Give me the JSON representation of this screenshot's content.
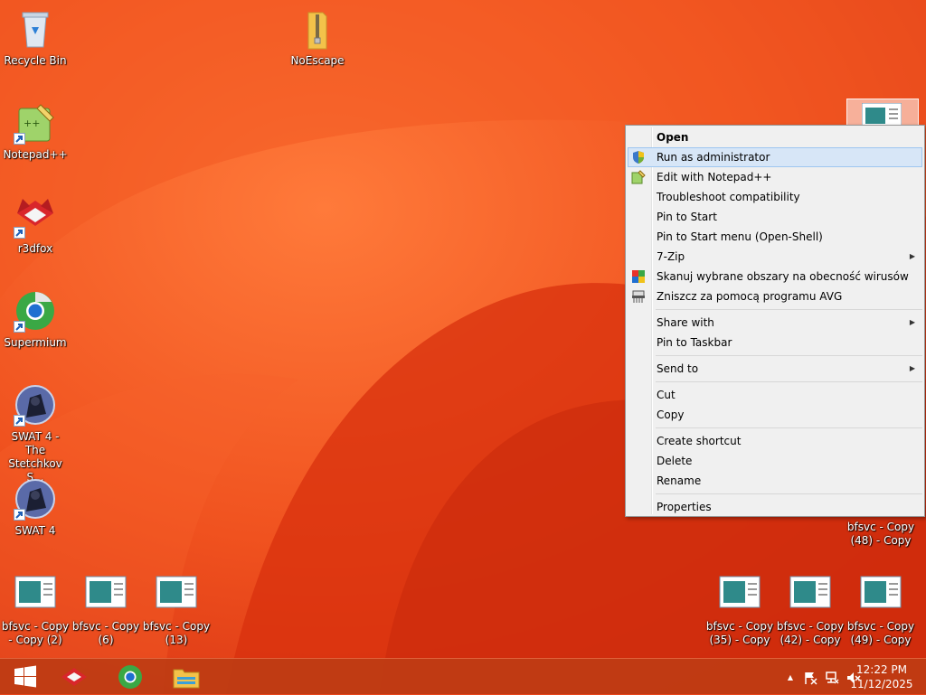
{
  "desktop": {
    "icons": [
      {
        "label": "Recycle Bin"
      },
      {
        "label": "NoEscape"
      },
      {
        "label": "Notepad++"
      },
      {
        "label": "r3dfox"
      },
      {
        "label": "Supermium"
      },
      {
        "label": "SWAT 4 - The Stetchkov S..."
      },
      {
        "label": "SWAT 4"
      },
      {
        "label": "bfsvc - Copy - Copy (2)"
      },
      {
        "label": "bfsvc - Copy (6)"
      },
      {
        "label": "bfsvc - Copy (13)"
      },
      {
        "label": "bfsvc - Copy (35) - Copy"
      },
      {
        "label": "bfsvc - Copy (42) - Copy"
      },
      {
        "label": "bfsvc - Copy (49) - Copy"
      },
      {
        "label": "bfsvc - Copy (48) - Copy"
      }
    ]
  },
  "context_menu": {
    "items": [
      {
        "label": "Open"
      },
      {
        "label": "Run as administrator"
      },
      {
        "label": "Edit with Notepad++"
      },
      {
        "label": "Troubleshoot compatibility"
      },
      {
        "label": "Pin to Start"
      },
      {
        "label": "Pin to Start menu (Open-Shell)"
      },
      {
        "label": "7-Zip"
      },
      {
        "label": "Skanuj wybrane obszary na obecność wirusów"
      },
      {
        "label": "Zniszcz za pomocą programu AVG"
      },
      {
        "label": "Share with"
      },
      {
        "label": "Pin to Taskbar"
      },
      {
        "label": "Send to"
      },
      {
        "label": "Cut"
      },
      {
        "label": "Copy"
      },
      {
        "label": "Create shortcut"
      },
      {
        "label": "Delete"
      },
      {
        "label": "Rename"
      },
      {
        "label": "Properties"
      }
    ],
    "submenu_glyph": "▶"
  },
  "taskbar": {
    "pinned": [
      "start-icon",
      "r3dfox-icon",
      "supermium-icon",
      "file-explorer-icon"
    ],
    "clock_time": "12:22 PM",
    "clock_date": "11/12/2025",
    "tray_chevron": "▲"
  },
  "colors": {
    "wallpaper": "#e8461a",
    "menu_highlight": "#d7e6f7"
  }
}
